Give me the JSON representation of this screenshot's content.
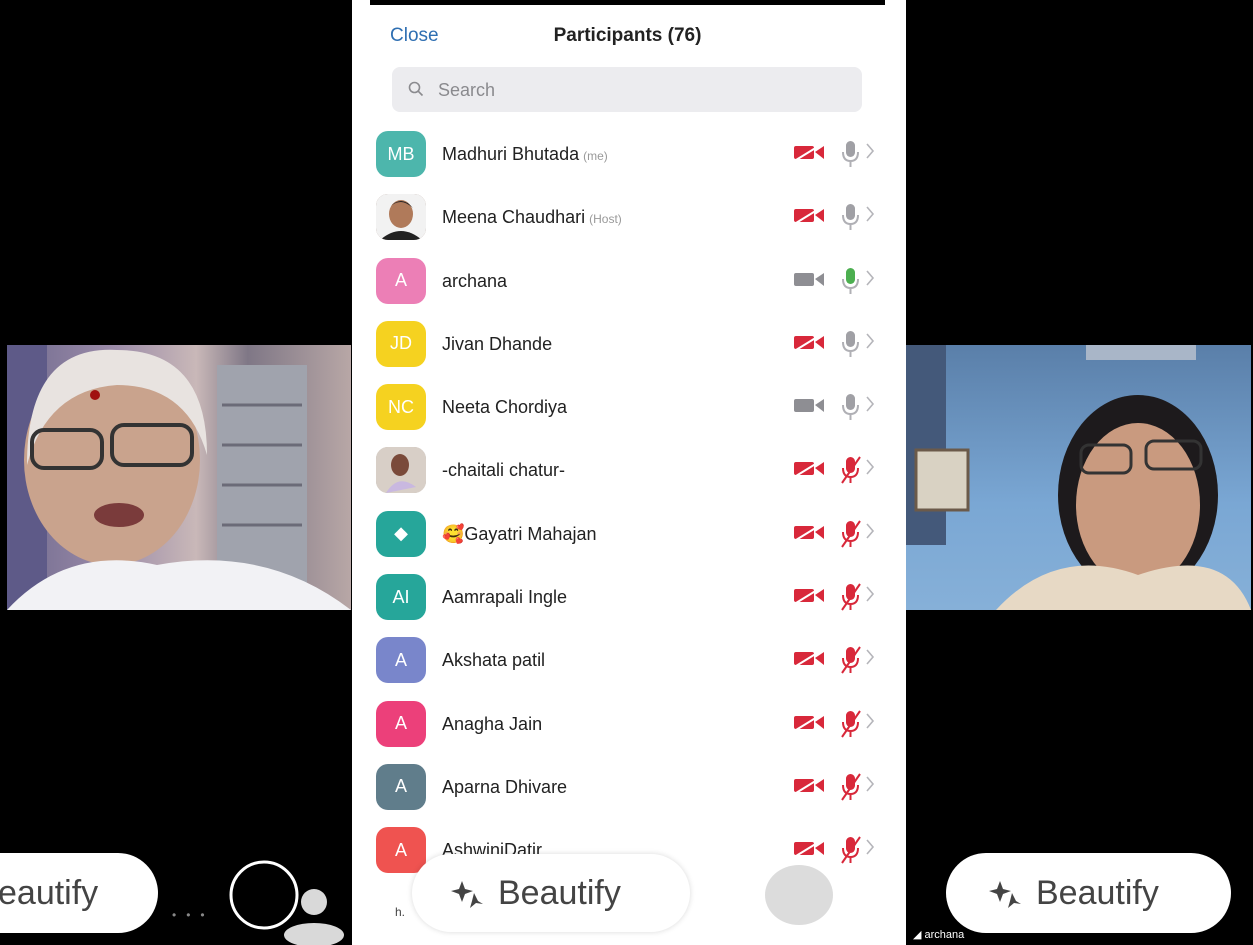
{
  "panel": {
    "close_label": "Close",
    "title": "Participants (76)",
    "search_placeholder": "Search"
  },
  "participants": [
    {
      "initials": "MB",
      "name": "Madhuri Bhutada",
      "tag": "(me)",
      "avatar_color": "#4db6ac",
      "video_on": false,
      "mic": "on-gray"
    },
    {
      "initials": "",
      "name": "Meena Chaudhari",
      "tag": "(Host)",
      "avatar_color": "#8d6e63",
      "photo": true,
      "video_on": false,
      "mic": "on-gray"
    },
    {
      "initials": "A",
      "name": "archana",
      "tag": "",
      "avatar_color": "#ec7fb6",
      "video_on": true,
      "mic": "on-green"
    },
    {
      "initials": "JD",
      "name": "Jivan Dhande",
      "tag": "",
      "avatar_color": "#f5d220",
      "video_on": false,
      "mic": "on-gray"
    },
    {
      "initials": "NC",
      "name": "Neeta Chordiya",
      "tag": "",
      "avatar_color": "#f5d220",
      "video_on": true,
      "mic": "on-gray"
    },
    {
      "initials": "",
      "name": "-chaitali chatur-",
      "tag": "",
      "avatar_color": "#b0a7a2",
      "photo": true,
      "video_on": false,
      "mic": "muted"
    },
    {
      "initials": "◆",
      "name": "🥰Gayatri Mahajan",
      "tag": "",
      "avatar_color": "#26a69a",
      "video_on": false,
      "mic": "muted"
    },
    {
      "initials": "AI",
      "name": "Aamrapali Ingle",
      "tag": "",
      "avatar_color": "#26a69a",
      "video_on": false,
      "mic": "muted"
    },
    {
      "initials": "A",
      "name": "Akshata  patil",
      "tag": "",
      "avatar_color": "#7986cb",
      "video_on": false,
      "mic": "muted"
    },
    {
      "initials": "A",
      "name": "Anagha Jain",
      "tag": "",
      "avatar_color": "#ec407a",
      "video_on": false,
      "mic": "muted"
    },
    {
      "initials": "A",
      "name": "Aparna Dhivare",
      "tag": "",
      "avatar_color": "#607d8b",
      "video_on": false,
      "mic": "muted"
    },
    {
      "initials": "A",
      "name": "AshwiniDatir",
      "tag": "",
      "avatar_color": "#ef5350",
      "video_on": false,
      "mic": "muted"
    }
  ],
  "overlays": {
    "beautify_left": "eautify",
    "beautify_center": "Beautify",
    "beautify_right": "Beautify",
    "bottom_left_partial": "h.",
    "speaker_label": "archana"
  },
  "colors": {
    "muted_red": "#d8283a",
    "video_gray": "#8e8e93",
    "mic_green": "#4caf50",
    "link_blue": "#2f6fb2"
  }
}
